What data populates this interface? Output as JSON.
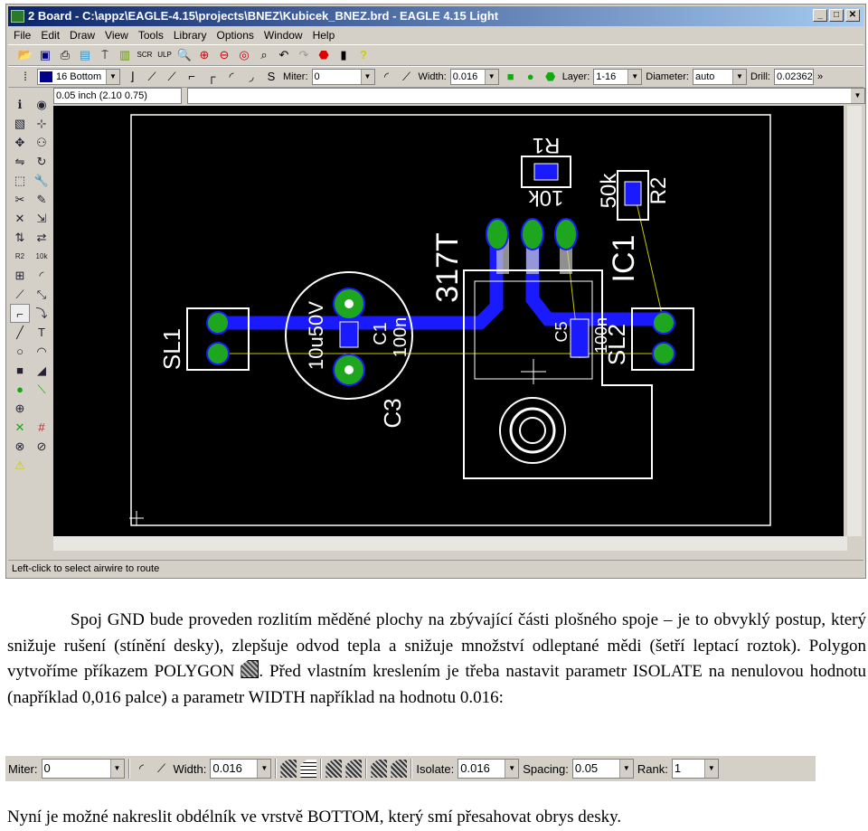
{
  "window": {
    "title": "2 Board - C:\\appz\\EAGLE-4.15\\projects\\BNEZ\\Kubicek_BNEZ.brd - EAGLE 4.15 Light",
    "menu": [
      "File",
      "Edit",
      "Draw",
      "View",
      "Tools",
      "Library",
      "Options",
      "Window",
      "Help"
    ],
    "toolbar2": {
      "layer": "16 Bottom",
      "miter_label": "Miter:",
      "miter": "0",
      "width_label": "Width:",
      "width": "0.016",
      "layer_label": "Layer:",
      "layer_range": "1-16",
      "diameter_label": "Diameter:",
      "diameter": "auto",
      "drill_label": "Drill:",
      "drill": "0.02362"
    },
    "coord": "0.05 inch (2.10 0.75)",
    "status": "Left-click to select airwire to route",
    "board_labels": {
      "r1": "R1",
      "r1_val": "10k",
      "r2": "R2",
      "r2_val": "50k",
      "ic1": "IC1",
      "ic1_val": "317T",
      "sl1": "SL1",
      "sl2": "SL2",
      "c1": "C1",
      "c1_val": "100n",
      "c3": "C3",
      "c3_val": "10u50V",
      "c5": "C5",
      "c5_val": "100n"
    },
    "colors": {
      "trace": "#1a1aff",
      "pad": "#1fa61f",
      "outline": "#ffffff",
      "airwire": "#c8c800"
    }
  },
  "text": {
    "p1a": "Spoj GND bude proveden rozlitím měděné plochy na zbývající části plošného spoje – je to obvyklý postup, který snižuje rušení (stínění desky), zlepšuje odvod tepla a snižuje množství odleptané mědi (šetří leptací roztok). Polygon vytvoříme příkazem POLYGON",
    "p1b": ". Před vlastním kreslením je třeba nastavit parametr ISOLATE na nenulovou hodnotu (například 0,016 palce) a parametr WIDTH například na hodnotu 0.016:",
    "p2": "Nyní je možné nakreslit obdélník ve vrstvě BOTTOM, který smí přesahovat obrys desky."
  },
  "polygon_toolbar": {
    "miter_label": "Miter:",
    "miter": "0",
    "width_label": "Width:",
    "width": "0.016",
    "isolate_label": "Isolate:",
    "isolate": "0.016",
    "spacing_label": "Spacing:",
    "spacing": "0.05",
    "rank_label": "Rank:",
    "rank": "1"
  }
}
